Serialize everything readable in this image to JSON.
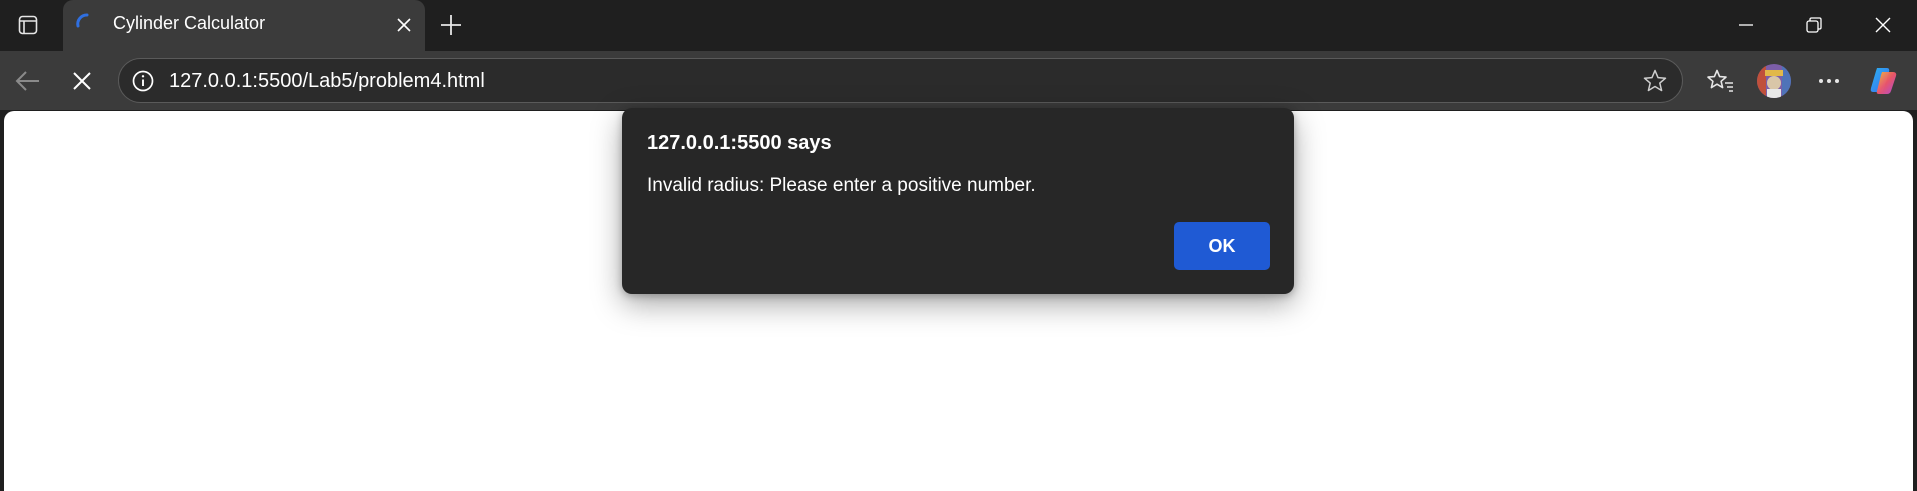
{
  "tab": {
    "title": "Cylinder Calculator",
    "favicon": "loading-spinner-icon"
  },
  "toolbar": {
    "back_icon": "back-arrow-icon",
    "stop_icon": "stop-loading-icon",
    "url": "127.0.0.1:5500/Lab5/problem4.html"
  },
  "dialog": {
    "title": "127.0.0.1:5500 says",
    "message": "Invalid radius: Please enter a positive number.",
    "ok_label": "OK"
  },
  "colors": {
    "chrome_bg": "#1f1f1f",
    "toolbar_bg": "#3b3b3b",
    "dialog_bg": "#272727",
    "accent": "#1f5ad4"
  }
}
